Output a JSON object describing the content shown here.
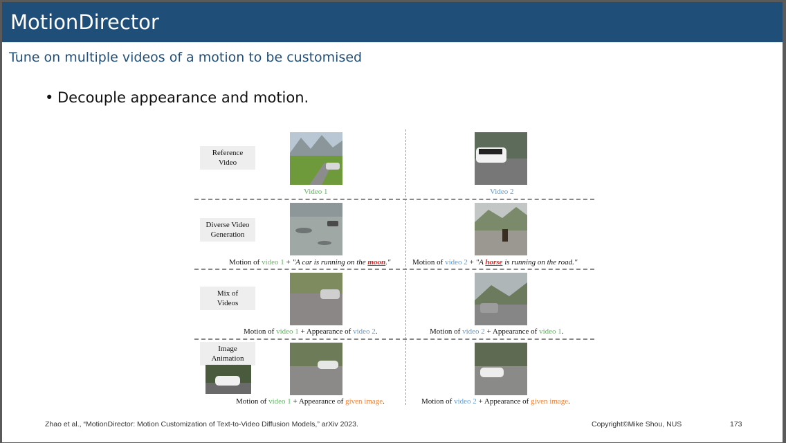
{
  "slide": {
    "title": "MotionDirector",
    "subtitle": "Tune on multiple videos of a motion to be customised",
    "bullet": "Decouple appearance and motion.",
    "footer_citation": "Zhao et al., “MotionDirector: Motion Customization of Text-to-Video Diffusion Models,” arXiv 2023.",
    "copyright": "Copyright©Mike Shou, NUS",
    "page_number": "173"
  },
  "figure": {
    "row_labels": [
      "Reference Video",
      "Diverse Video Generation",
      "Mix of Videos",
      "Image Animation"
    ],
    "video1_label": "Video 1",
    "video2_label": "Video 2",
    "captions": {
      "motion_of": "Motion of",
      "video1": "video 1",
      "video2": "video 2",
      "plus": "+",
      "appearance_of": "Appearance of",
      "given_image": "given image",
      "period": ".",
      "gen1_pre": "\"A car is running on the ",
      "gen1_em": "moon",
      "gen1_post": ".\"",
      "gen2_pre": "\"A ",
      "gen2_em": "horse",
      "gen2_post": " is running on the road.\""
    }
  },
  "colors": {
    "title_bar": "#1f4e79",
    "video1": "#5cb85c",
    "video2": "#5b9bd5",
    "given_image": "#ed7d31",
    "highlight": "#d62728"
  }
}
